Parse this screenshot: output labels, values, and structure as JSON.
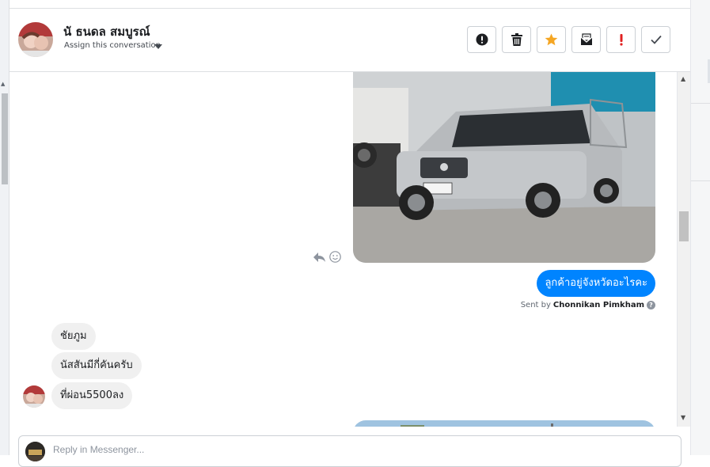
{
  "conversation": {
    "contact_name": "นั ธนดล สมบูรณ์",
    "assign_label": "Assign this conversation"
  },
  "actions": [
    {
      "name": "report-button",
      "icon": "exclamation-circle-icon"
    },
    {
      "name": "delete-button",
      "icon": "trash-icon"
    },
    {
      "name": "star-button",
      "icon": "star-icon"
    },
    {
      "name": "mark-unread-button",
      "icon": "envelope-icon"
    },
    {
      "name": "follow-up-button",
      "icon": "exclamation-icon"
    },
    {
      "name": "mark-done-button",
      "icon": "checkmark-icon"
    }
  ],
  "messages": {
    "outgoing_text": "ลูกค้าอยู่จังหวัดอะไรคะ",
    "sent_by_prefix": "Sent by",
    "sent_by_name": "Chonnikan Pimkham",
    "incoming": [
      {
        "text": "ชัยภูม"
      },
      {
        "text": "นัสสันมีกี่คันครับ"
      },
      {
        "text": "ที่ผ่อน5500ลง"
      }
    ]
  },
  "reply": {
    "placeholder": "Reply in Messenger..."
  },
  "colors": {
    "messenger_blue": "#0084ff",
    "star_orange": "#f5a623",
    "alert_red": "#e02020"
  }
}
